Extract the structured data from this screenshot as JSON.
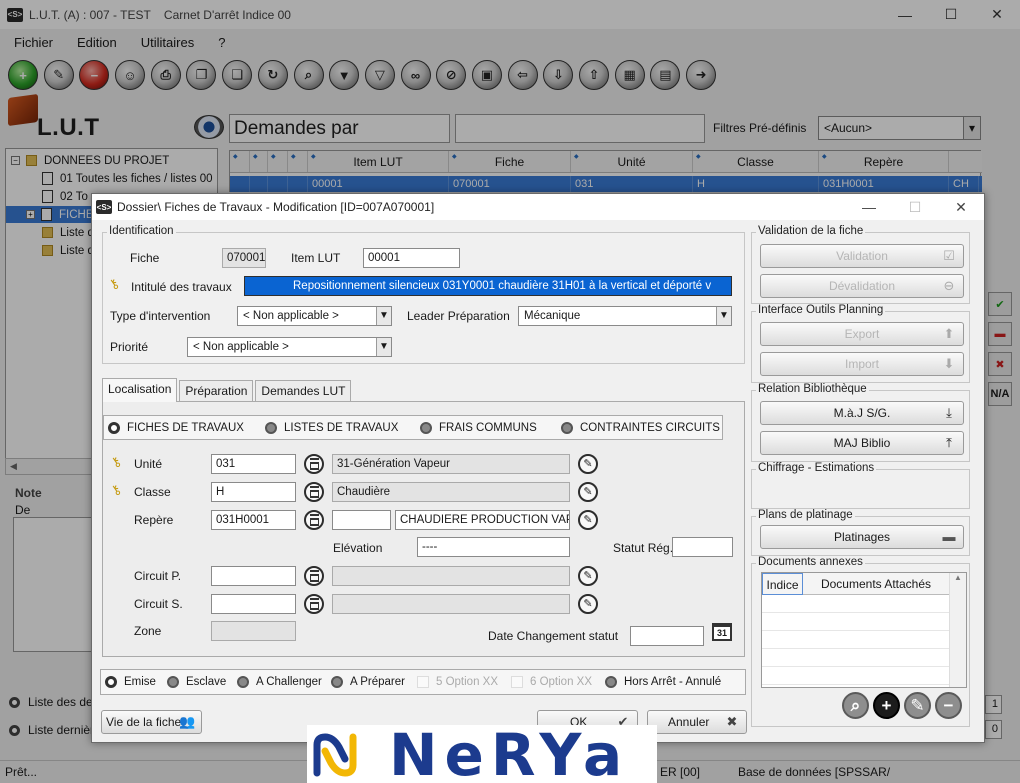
{
  "main": {
    "title": "L.U.T. (A) : 007 - TEST    Carnet D'arrêt Indice 00",
    "app_icon": "<S>",
    "menu": [
      "Fichier",
      "Edition",
      "Utilitaires",
      "?"
    ],
    "logo_text": "L.U.T",
    "title_box": "Demandes par",
    "filters_label": "Filtres Pré-définis",
    "filters_value": "<Aucun>",
    "tree": [
      {
        "label": "DONNEES DU PROJET",
        "kind": "folder",
        "expander": "⊟"
      },
      {
        "label": "01 Toutes les fiches / listes 00",
        "kind": "doc"
      },
      {
        "label": "02 To",
        "kind": "doc"
      },
      {
        "label": "FICHE",
        "kind": "doc",
        "expander": "⊞",
        "selected": true
      },
      {
        "label": "Liste d",
        "kind": "folder"
      },
      {
        "label": "Liste d",
        "kind": "folder"
      }
    ],
    "grid_headers": [
      "",
      "",
      "",
      "",
      "Item LUT",
      "Fiche",
      "Unité",
      "Classe",
      "Repère"
    ],
    "grid_row": [
      "",
      "",
      "",
      "",
      "00001",
      "070001",
      "031",
      "H",
      "031H0001",
      "CH"
    ],
    "side_icons": {
      "na": "N/A"
    },
    "note_label": "Note",
    "de_label": "De",
    "radio1": "Liste des dern",
    "radio2": "Liste dernièr",
    "num1": "1",
    "num2": "0",
    "status_ready": "Prêt...",
    "status_er": "ER [00]",
    "status_db": "Base de données [SPSSAR/"
  },
  "dialog": {
    "title": "Dossier\\ Fiches de Travaux - Modification [ID=007A070001]",
    "identification": {
      "group": "Identification",
      "fiche_label": "Fiche",
      "fiche_value": "070001",
      "item_lut_label": "Item LUT",
      "item_lut_value": "00001",
      "intitule_label": "Intitulé des travaux",
      "intitule_value": "Repositionnement silencieux 031Y0001 chaudière 31H01 à la vertical et déporté v",
      "type_label": "Type d'intervention",
      "type_value": "< Non applicable >",
      "leader_label": "Leader Préparation",
      "leader_value": "Mécanique",
      "priorite_label": "Priorité",
      "priorite_value": "< Non applicable >"
    },
    "tabs": [
      "Localisation",
      "Préparation",
      "Demandes LUT"
    ],
    "loc_radios": [
      "FICHES DE TRAVAUX",
      "LISTES DE TRAVAUX",
      "FRAIS COMMUNS",
      "CONTRAINTES CIRCUITS"
    ],
    "unite_label": "Unité",
    "unite_code": "031",
    "unite_desc": "31-Génération Vapeur",
    "classe_label": "Classe",
    "classe_code": "H",
    "classe_desc": "Chaudière",
    "repere_label": "Repère",
    "repere_code": "031H0001",
    "repere_mid": "",
    "repere_desc": "CHAUDIERE PRODUCTION VAPEUR",
    "elevation_label": "Elévation",
    "elevation_value": "----",
    "statut_reg_label": "Statut Rég.",
    "circuit_p_label": "Circuit P.",
    "circuit_s_label": "Circuit S.",
    "zone_label": "Zone",
    "date_chg_label": "Date Changement statut",
    "cal_day": "31",
    "states": [
      "Emise",
      "Esclave",
      "A Challenger",
      "A Préparer",
      "5 Option XX",
      "6 Option XX",
      "Hors Arrêt - Annulé"
    ],
    "vie_button": "Vie de la fiche",
    "ok_button": "OK",
    "cancel_button": "Annuler",
    "right": {
      "validation_group": "Validation de la fiche",
      "validation": "Validation",
      "devalidation": "Dévalidation",
      "planning_group": "Interface Outils Planning",
      "export": "Export",
      "import": "Import",
      "biblio_group": "Relation Bibliothèque",
      "maj_sg": "M.à.J S/G.",
      "maj_biblio": "MAJ Biblio",
      "chiffrage_group": "Chiffrage - Estimations",
      "plans_group": "Plans de platinage",
      "platinages": "Platinages",
      "docs_group": "Documents annexes",
      "docs_head_indice": "Indice",
      "docs_head_attached": "Documents Attachés"
    }
  },
  "overlay": {
    "brand": "NeRYa"
  },
  "colors": {
    "selection": "#0a64d2",
    "brand_blue": "#1c3b8e",
    "brand_yellow": "#f2b705"
  }
}
